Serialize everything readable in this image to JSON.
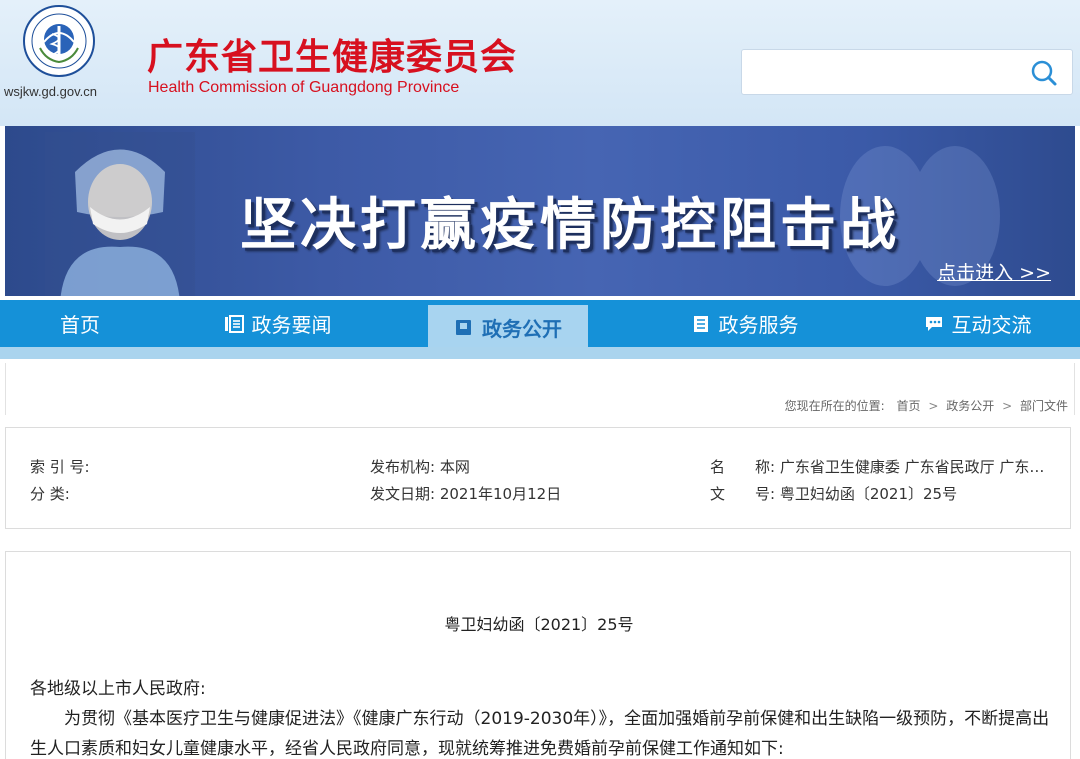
{
  "header": {
    "domain": "wsjkw.gd.gov.cn",
    "title_cn": "广东省卫生健康委员会",
    "title_en": "Health Commission of Guangdong Province",
    "search_placeholder": ""
  },
  "banner": {
    "title": "坚决打赢疫情防控阻击战",
    "link": "点击进入 >>"
  },
  "nav": {
    "items": [
      {
        "label": "首页",
        "icon": "",
        "active": false
      },
      {
        "label": "政务要闻",
        "icon": "news-icon",
        "active": false
      },
      {
        "label": "政务公开",
        "icon": "folder-icon",
        "active": true
      },
      {
        "label": "政务服务",
        "icon": "document-icon",
        "active": false
      },
      {
        "label": "互动交流",
        "icon": "chat-icon",
        "active": false
      }
    ]
  },
  "breadcrumb": {
    "prefix": "您现在所在的位置:",
    "items": [
      "首页",
      "政务公开",
      "部门文件"
    ],
    "sep": ">"
  },
  "meta": {
    "index_label": "索 引 号:",
    "index_value": "",
    "category_label": "分 类:",
    "category_value": "",
    "publisher_label": "发布机构:",
    "publisher_value": "本网",
    "date_label": "发文日期:",
    "date_value": "2021年10月12日",
    "name_label": "名　　称:",
    "name_value": "广东省卫生健康委 广东省民政厅 广东…",
    "docno_label": "文　　号:",
    "docno_value": "粤卫妇幼函〔2021〕25号"
  },
  "article": {
    "doc_number": "粤卫妇幼函〔2021〕25号",
    "salutation": "各地级以上市人民政府:",
    "paragraph": "为贯彻《基本医疗卫生与健康促进法》《健康广东行动（2019-2030年）》，全面加强婚前孕前保健和出生缺陷一级预防，不断提高出生人口素质和妇女儿童健康水平，经省人民政府同意，现就统筹推进免费婚前孕前保健工作通知如下:"
  },
  "colors": {
    "brand_red": "#d7101f",
    "nav_blue": "#1591d8",
    "nav_active": "#a8d4f0",
    "banner_blue": "#3d5aa6"
  }
}
